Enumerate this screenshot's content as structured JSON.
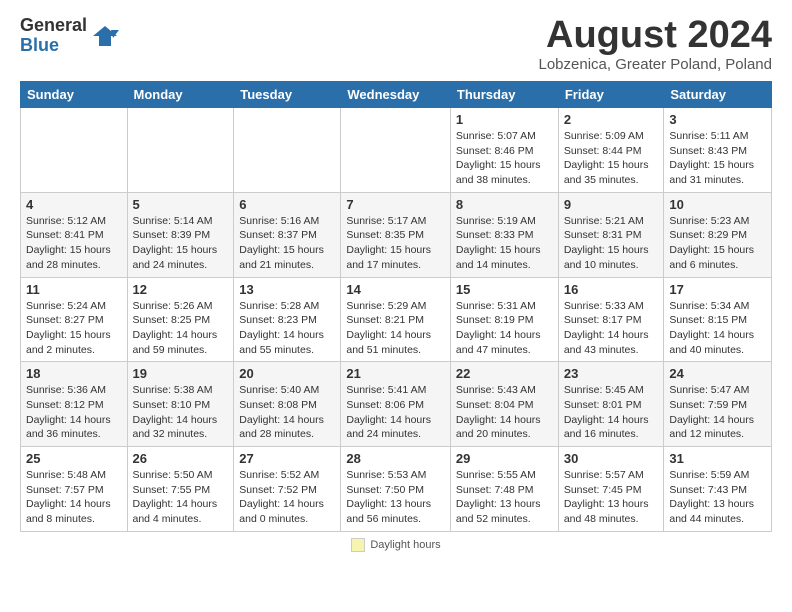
{
  "logo": {
    "general": "General",
    "blue": "Blue"
  },
  "title": "August 2024",
  "location": "Lobzenica, Greater Poland, Poland",
  "days_of_week": [
    "Sunday",
    "Monday",
    "Tuesday",
    "Wednesday",
    "Thursday",
    "Friday",
    "Saturday"
  ],
  "footer_label": "Daylight hours",
  "weeks": [
    [
      {
        "day": "",
        "info": ""
      },
      {
        "day": "",
        "info": ""
      },
      {
        "day": "",
        "info": ""
      },
      {
        "day": "",
        "info": ""
      },
      {
        "day": "1",
        "info": "Sunrise: 5:07 AM\nSunset: 8:46 PM\nDaylight: 15 hours\nand 38 minutes."
      },
      {
        "day": "2",
        "info": "Sunrise: 5:09 AM\nSunset: 8:44 PM\nDaylight: 15 hours\nand 35 minutes."
      },
      {
        "day": "3",
        "info": "Sunrise: 5:11 AM\nSunset: 8:43 PM\nDaylight: 15 hours\nand 31 minutes."
      }
    ],
    [
      {
        "day": "4",
        "info": "Sunrise: 5:12 AM\nSunset: 8:41 PM\nDaylight: 15 hours\nand 28 minutes."
      },
      {
        "day": "5",
        "info": "Sunrise: 5:14 AM\nSunset: 8:39 PM\nDaylight: 15 hours\nand 24 minutes."
      },
      {
        "day": "6",
        "info": "Sunrise: 5:16 AM\nSunset: 8:37 PM\nDaylight: 15 hours\nand 21 minutes."
      },
      {
        "day": "7",
        "info": "Sunrise: 5:17 AM\nSunset: 8:35 PM\nDaylight: 15 hours\nand 17 minutes."
      },
      {
        "day": "8",
        "info": "Sunrise: 5:19 AM\nSunset: 8:33 PM\nDaylight: 15 hours\nand 14 minutes."
      },
      {
        "day": "9",
        "info": "Sunrise: 5:21 AM\nSunset: 8:31 PM\nDaylight: 15 hours\nand 10 minutes."
      },
      {
        "day": "10",
        "info": "Sunrise: 5:23 AM\nSunset: 8:29 PM\nDaylight: 15 hours\nand 6 minutes."
      }
    ],
    [
      {
        "day": "11",
        "info": "Sunrise: 5:24 AM\nSunset: 8:27 PM\nDaylight: 15 hours\nand 2 minutes."
      },
      {
        "day": "12",
        "info": "Sunrise: 5:26 AM\nSunset: 8:25 PM\nDaylight: 14 hours\nand 59 minutes."
      },
      {
        "day": "13",
        "info": "Sunrise: 5:28 AM\nSunset: 8:23 PM\nDaylight: 14 hours\nand 55 minutes."
      },
      {
        "day": "14",
        "info": "Sunrise: 5:29 AM\nSunset: 8:21 PM\nDaylight: 14 hours\nand 51 minutes."
      },
      {
        "day": "15",
        "info": "Sunrise: 5:31 AM\nSunset: 8:19 PM\nDaylight: 14 hours\nand 47 minutes."
      },
      {
        "day": "16",
        "info": "Sunrise: 5:33 AM\nSunset: 8:17 PM\nDaylight: 14 hours\nand 43 minutes."
      },
      {
        "day": "17",
        "info": "Sunrise: 5:34 AM\nSunset: 8:15 PM\nDaylight: 14 hours\nand 40 minutes."
      }
    ],
    [
      {
        "day": "18",
        "info": "Sunrise: 5:36 AM\nSunset: 8:12 PM\nDaylight: 14 hours\nand 36 minutes."
      },
      {
        "day": "19",
        "info": "Sunrise: 5:38 AM\nSunset: 8:10 PM\nDaylight: 14 hours\nand 32 minutes."
      },
      {
        "day": "20",
        "info": "Sunrise: 5:40 AM\nSunset: 8:08 PM\nDaylight: 14 hours\nand 28 minutes."
      },
      {
        "day": "21",
        "info": "Sunrise: 5:41 AM\nSunset: 8:06 PM\nDaylight: 14 hours\nand 24 minutes."
      },
      {
        "day": "22",
        "info": "Sunrise: 5:43 AM\nSunset: 8:04 PM\nDaylight: 14 hours\nand 20 minutes."
      },
      {
        "day": "23",
        "info": "Sunrise: 5:45 AM\nSunset: 8:01 PM\nDaylight: 14 hours\nand 16 minutes."
      },
      {
        "day": "24",
        "info": "Sunrise: 5:47 AM\nSunset: 7:59 PM\nDaylight: 14 hours\nand 12 minutes."
      }
    ],
    [
      {
        "day": "25",
        "info": "Sunrise: 5:48 AM\nSunset: 7:57 PM\nDaylight: 14 hours\nand 8 minutes."
      },
      {
        "day": "26",
        "info": "Sunrise: 5:50 AM\nSunset: 7:55 PM\nDaylight: 14 hours\nand 4 minutes."
      },
      {
        "day": "27",
        "info": "Sunrise: 5:52 AM\nSunset: 7:52 PM\nDaylight: 14 hours\nand 0 minutes."
      },
      {
        "day": "28",
        "info": "Sunrise: 5:53 AM\nSunset: 7:50 PM\nDaylight: 13 hours\nand 56 minutes."
      },
      {
        "day": "29",
        "info": "Sunrise: 5:55 AM\nSunset: 7:48 PM\nDaylight: 13 hours\nand 52 minutes."
      },
      {
        "day": "30",
        "info": "Sunrise: 5:57 AM\nSunset: 7:45 PM\nDaylight: 13 hours\nand 48 minutes."
      },
      {
        "day": "31",
        "info": "Sunrise: 5:59 AM\nSunset: 7:43 PM\nDaylight: 13 hours\nand 44 minutes."
      }
    ]
  ]
}
